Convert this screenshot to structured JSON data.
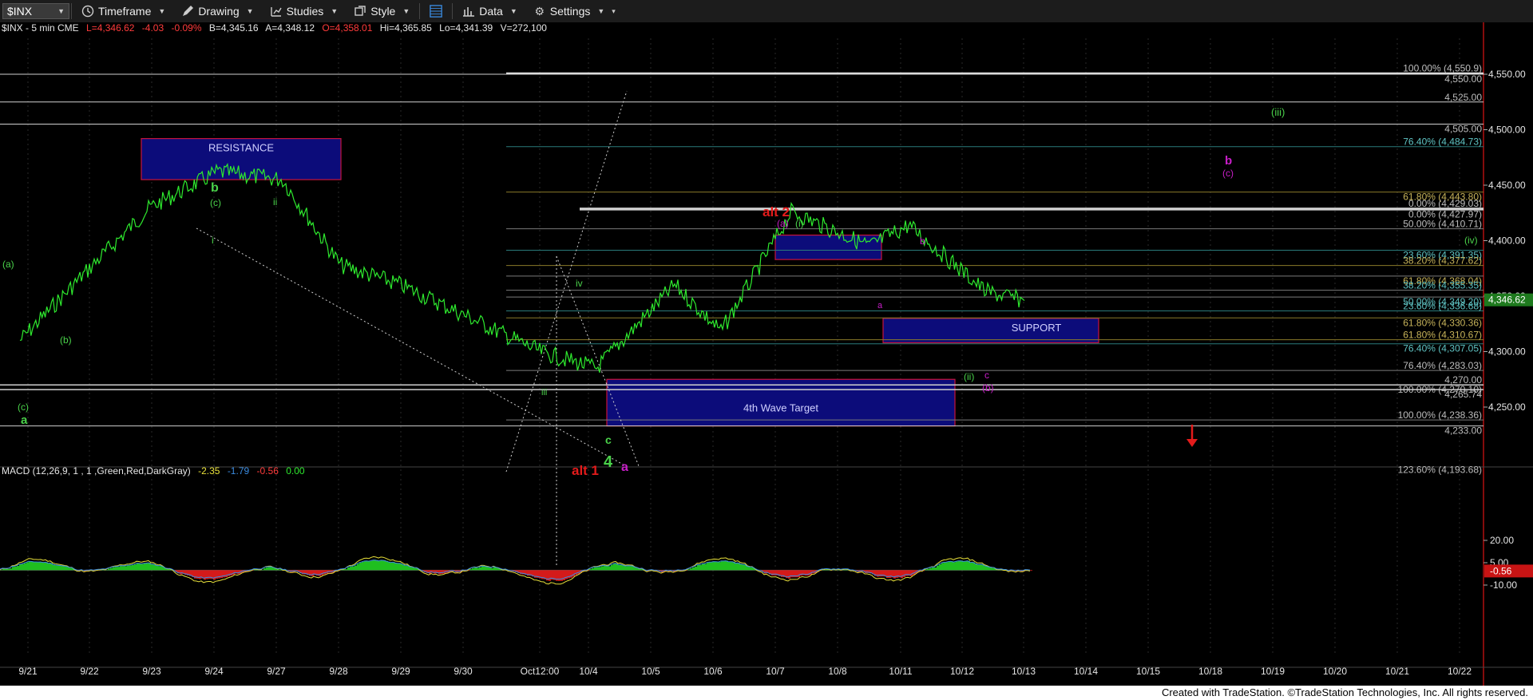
{
  "toolbar": {
    "symbol": "$INX",
    "timeframe": "Timeframe",
    "drawing": "Drawing",
    "studies": "Studies",
    "style": "Style",
    "data": "Data",
    "settings": "Settings"
  },
  "header": {
    "symbol": "$INX - 5 min  CME",
    "last": "L=4,346.62",
    "change": "-4.03",
    "change_pct": "-0.09%",
    "bid": "B=4,345.16",
    "ask": "A=4,348.12",
    "open": "O=4,358.01",
    "high": "Hi=4,365.85",
    "low": "Lo=4,341.39",
    "volume": "V=272,100"
  },
  "footer": {
    "text": "Created with TradeStation. ©TradeStation Technologies, Inc. All rights reserved."
  },
  "colors": {
    "price": "#2eea2e",
    "red": "#e31b1b",
    "magenta": "#c81ec8",
    "green_label": "#4ad24a",
    "box_fill": "#0c0c7a",
    "box_border": "#c8143c"
  },
  "chart_data": [
    {
      "type": "line",
      "title": "$INX - 5 min",
      "y_axis_ticks": [
        "4,550.00",
        "4,500.00",
        "4,450.00",
        "4,400.00",
        "4,350.00",
        "4,300.00",
        "4,250.00"
      ],
      "ylim": [
        4188,
        4598
      ],
      "x_axis_ticks": [
        "9/21",
        "9/22",
        "9/23",
        "9/24",
        "9/27",
        "9/28",
        "9/29",
        "9/30",
        "Oct12:00",
        "10/4",
        "10/5",
        "10/6",
        "10/7",
        "10/8",
        "10/11",
        "10/12",
        "10/13",
        "10/14",
        "10/15",
        "10/18",
        "10/19",
        "10/20",
        "10/21",
        "10/22"
      ],
      "last_price": "4,346.62",
      "price_series": {
        "name": "$INX",
        "x": [
          "9/21",
          "9/22",
          "9/23",
          "9/24",
          "9/27",
          "9/28",
          "9/29",
          "9/30",
          "Oct12:00",
          "10/4",
          "10/5",
          "10/6",
          "10/7",
          "10/8",
          "10/11",
          "10/12",
          "10/13"
        ],
        "y": [
          4310,
          4375,
          4430,
          4462,
          4455,
          4378,
          4360,
          4330,
          4300,
          4285,
          4360,
          4318,
          4426,
          4395,
          4414,
          4354,
          4346
        ]
      },
      "price_levels": [
        {
          "label": "100.00% (4,550.9)",
          "value": 4550.9
        },
        {
          "label": "4,550.00",
          "value": 4550.0
        },
        {
          "label": "4,525.00",
          "value": 4525.0
        },
        {
          "label": "4,505.00",
          "value": 4505.0
        },
        {
          "label": "76.40% (4,484.73)",
          "value": 4484.73
        },
        {
          "label": "61.80% (4,443.80)",
          "value": 4443.8
        },
        {
          "label": "0.00% (4,429.03)",
          "value": 4429.03
        },
        {
          "label": "0.00% (4,427.97)",
          "value": 4427.97
        },
        {
          "label": "50.00% (4,410.71)",
          "value": 4410.71
        },
        {
          "label": "23.60% (4,391.35)",
          "value": 4391.35
        },
        {
          "label": "38.20% (4,377.62)",
          "value": 4377.62
        },
        {
          "label": "61.80% (4,368.04)",
          "value": 4368.04
        },
        {
          "label": "38.20% (4,355.35)",
          "value": 4355.35
        },
        {
          "label": "50.00% (4,349.20)",
          "value": 4349.2
        },
        {
          "label": "23.60% (4,336.68)",
          "value": 4336.68
        },
        {
          "label": "61.80% (4,330.36)",
          "value": 4330.36
        },
        {
          "label": "61.80% (4,310.67)",
          "value": 4310.67
        },
        {
          "label": "76.40% (4,307.05)",
          "value": 4307.05
        },
        {
          "label": "76.40% (4,283.03)",
          "value": 4283.03
        },
        {
          "label": "100.00% (4,270.10)",
          "value": 4270.1
        },
        {
          "label": "4,270.00",
          "value": 4270.0
        },
        {
          "label": "4,265.74",
          "value": 4265.74
        },
        {
          "label": "100.00% (4,238.36)",
          "value": 4238.36
        },
        {
          "label": "4,233.00",
          "value": 4233.0
        },
        {
          "label": "123.60% (4,193.68)",
          "value": 4193.68
        }
      ],
      "zones": [
        {
          "label": "RESISTANCE",
          "x_range": [
            "9/22",
            "9/28"
          ],
          "y_range": [
            4455,
            4492
          ]
        },
        {
          "label": "SUPPORT",
          "x_range": [
            "10/11",
            "10/13"
          ],
          "y_range": [
            4308,
            4330
          ]
        },
        {
          "label": "4th Wave Target",
          "x_range": [
            "10/4",
            "10/12"
          ],
          "y_range": [
            4233,
            4275
          ]
        },
        {
          "label": "",
          "x_range": [
            "10/7",
            "10/8"
          ],
          "y_range": [
            4383,
            4405
          ]
        }
      ],
      "annotations": [
        {
          "text": "(a)",
          "color": "green"
        },
        {
          "text": "(b)",
          "color": "green"
        },
        {
          "text": "(c)",
          "color": "green"
        },
        {
          "text": "a",
          "color": "green"
        },
        {
          "text": "b",
          "color": "green"
        },
        {
          "text": "(c)",
          "color": "green"
        },
        {
          "text": "ii",
          "color": "green"
        },
        {
          "text": "i",
          "color": "green"
        },
        {
          "text": "iii",
          "color": "green"
        },
        {
          "text": "iv",
          "color": "green"
        },
        {
          "text": "c",
          "color": "green"
        },
        {
          "text": "4",
          "color": "green"
        },
        {
          "text": "alt 1",
          "color": "red"
        },
        {
          "text": "a",
          "color": "magenta"
        },
        {
          "text": "alt 2",
          "color": "red"
        },
        {
          "text": "(a)",
          "color": "magenta"
        },
        {
          "text": "(i)",
          "color": "green"
        },
        {
          "text": "a",
          "color": "magenta"
        },
        {
          "text": "b",
          "color": "magenta"
        },
        {
          "text": "(ii)",
          "color": "green"
        },
        {
          "text": "c",
          "color": "magenta"
        },
        {
          "text": "(b)",
          "color": "magenta"
        },
        {
          "text": "(iii)",
          "color": "green"
        },
        {
          "text": "(iv)",
          "color": "green"
        },
        {
          "text": "b",
          "color": "magenta"
        },
        {
          "text": "(c)",
          "color": "magenta"
        }
      ]
    },
    {
      "type": "line",
      "title": "MACD (12,26,9, 1 , 1 ,Green,Red,DarkGray)",
      "values_shown": [
        "-2.35",
        "-1.79",
        "-0.56",
        "0.00"
      ],
      "y_axis_ticks": [
        "20.00",
        "5.00",
        "-0.56",
        "-10.00"
      ],
      "ylim": [
        -17,
        25
      ],
      "grid": false,
      "legend": "top-left"
    }
  ]
}
